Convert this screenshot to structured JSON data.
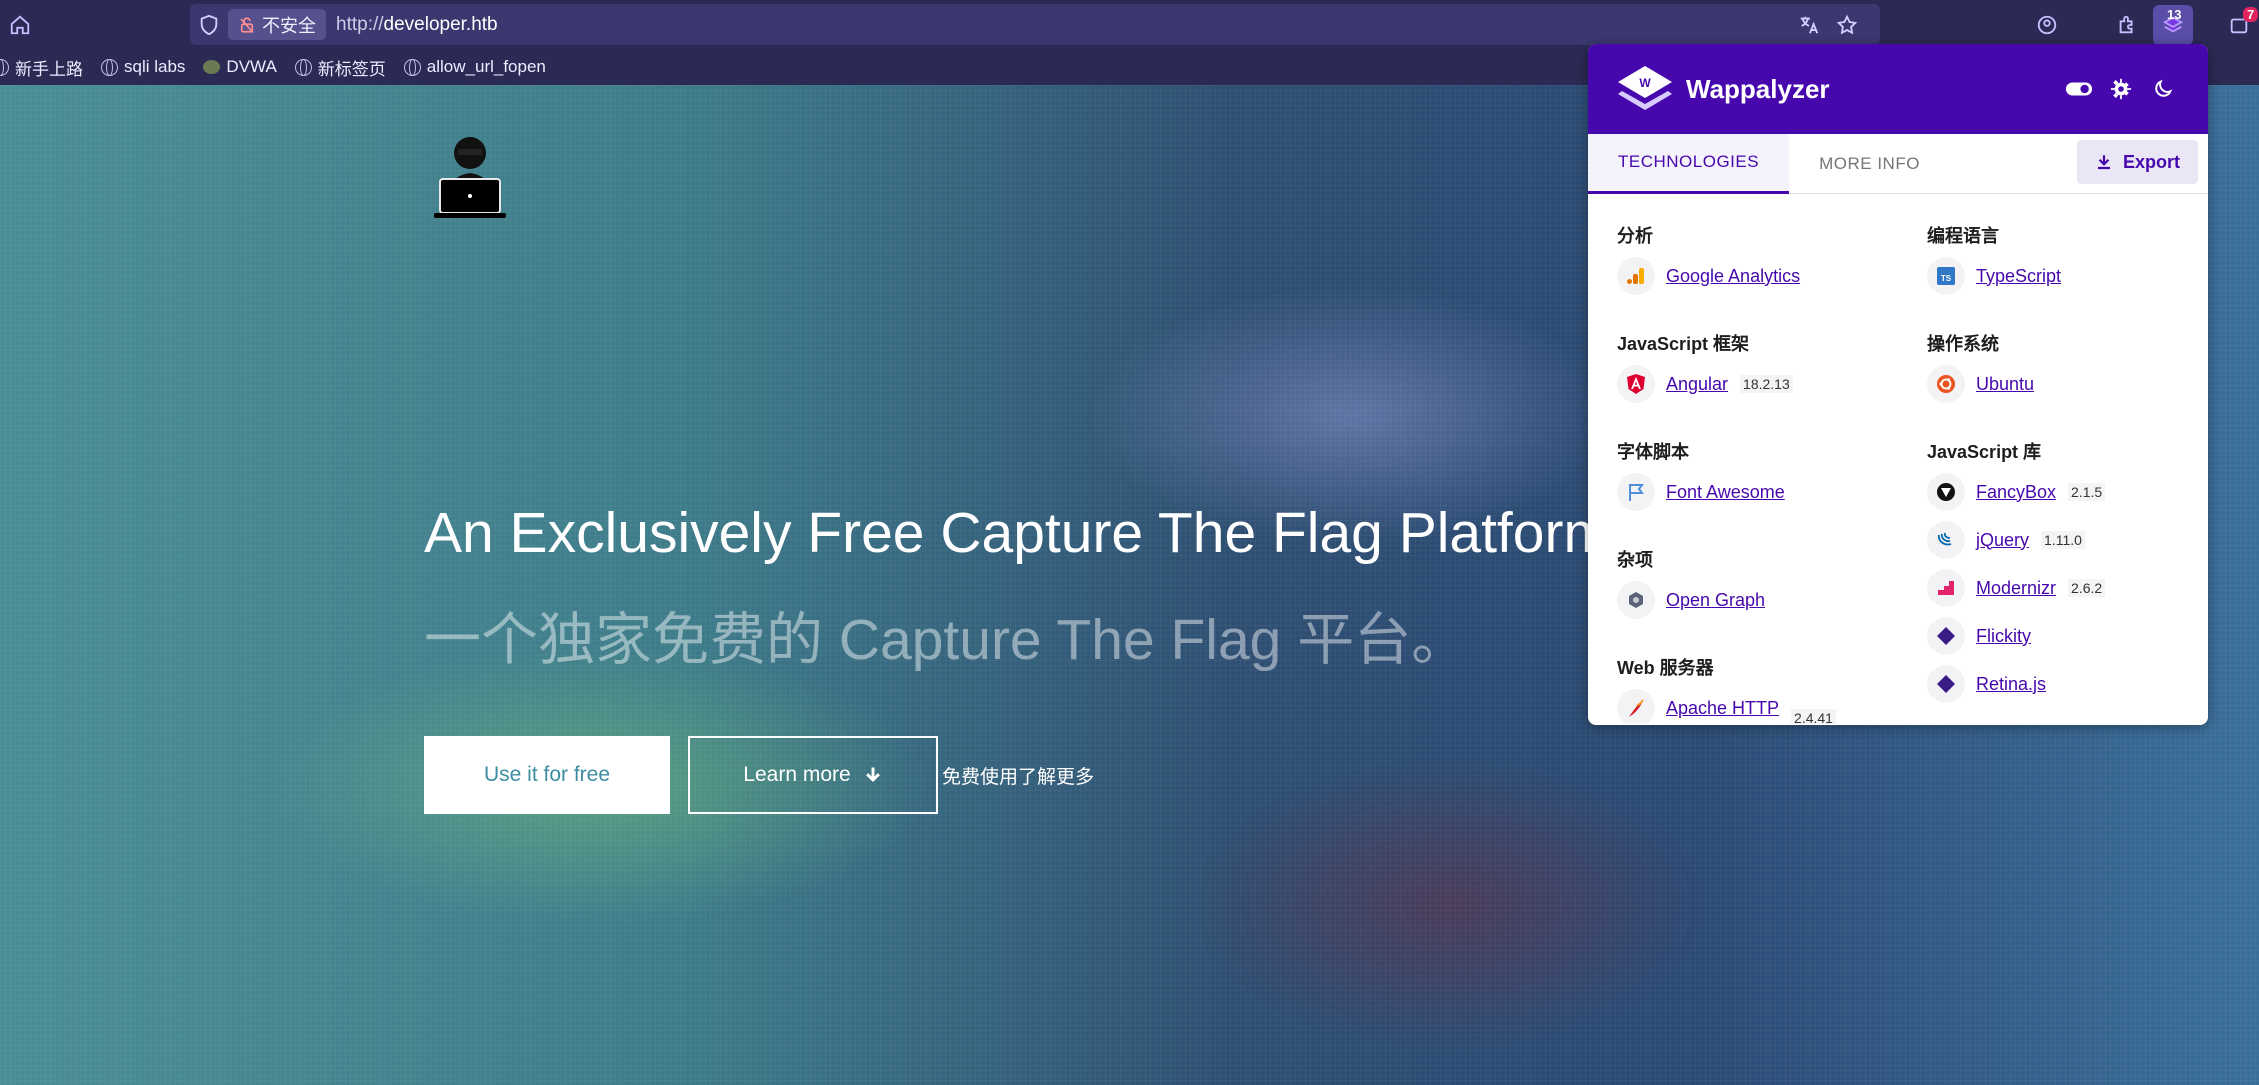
{
  "browser": {
    "security_label": "不安全",
    "url_prefix": "http://",
    "url_host": "developer.htb",
    "extension_badge": "13",
    "notif_badge": "7",
    "bookmarks": [
      {
        "label": "新手上路",
        "icon": "globe-icon"
      },
      {
        "label": "sqli labs",
        "icon": "globe-icon"
      },
      {
        "label": "DVWA",
        "icon": "dvwa-icon"
      },
      {
        "label": "新标签页",
        "icon": "globe-icon"
      },
      {
        "label": "allow_url_fopen",
        "icon": "globe-icon"
      }
    ]
  },
  "hero": {
    "title": "An Exclusively Free Capture The Flag Platform.",
    "subtitle": "一个独家免费的 Capture The Flag 平台。",
    "use_free_label": "Use it for free",
    "learn_more_label": "Learn more",
    "note": "免费使用了解更多"
  },
  "wappalyzer": {
    "brand": "Wappalyzer",
    "tabs": [
      "TECHNOLOGIES",
      "MORE INFO"
    ],
    "export_label": "Export",
    "colors": {
      "brand": "#4608ad"
    },
    "left": [
      {
        "category": "分析",
        "techs": [
          {
            "name": "Google Analytics",
            "version": "",
            "icon": "google-analytics-icon"
          }
        ]
      },
      {
        "category": "JavaScript 框架",
        "techs": [
          {
            "name": "Angular",
            "version": "18.2.13",
            "icon": "angular-icon"
          }
        ]
      },
      {
        "category": "字体脚本",
        "techs": [
          {
            "name": "Font Awesome",
            "version": "",
            "icon": "font-awesome-icon"
          }
        ]
      },
      {
        "category": "杂项",
        "techs": [
          {
            "name": "Open Graph",
            "version": "",
            "icon": "open-graph-icon"
          }
        ]
      },
      {
        "category": "Web 服务器",
        "techs": [
          {
            "name": "Apache HTTP",
            "version": "2.4.41",
            "icon": "apache-icon"
          }
        ]
      }
    ],
    "right": [
      {
        "category": "编程语言",
        "techs": [
          {
            "name": "TypeScript",
            "version": "",
            "icon": "typescript-icon"
          }
        ]
      },
      {
        "category": "操作系统",
        "techs": [
          {
            "name": "Ubuntu",
            "version": "",
            "icon": "ubuntu-icon"
          }
        ]
      },
      {
        "category": "JavaScript 库",
        "techs": [
          {
            "name": "FancyBox",
            "version": "2.1.5",
            "icon": "fancybox-icon"
          },
          {
            "name": "jQuery",
            "version": "1.11.0",
            "icon": "jquery-icon"
          },
          {
            "name": "Modernizr",
            "version": "2.6.2",
            "icon": "modernizr-icon"
          },
          {
            "name": "Flickity",
            "version": "",
            "icon": "flickity-icon"
          },
          {
            "name": "Retina.js",
            "version": "",
            "icon": "retina-icon"
          }
        ]
      }
    ]
  }
}
